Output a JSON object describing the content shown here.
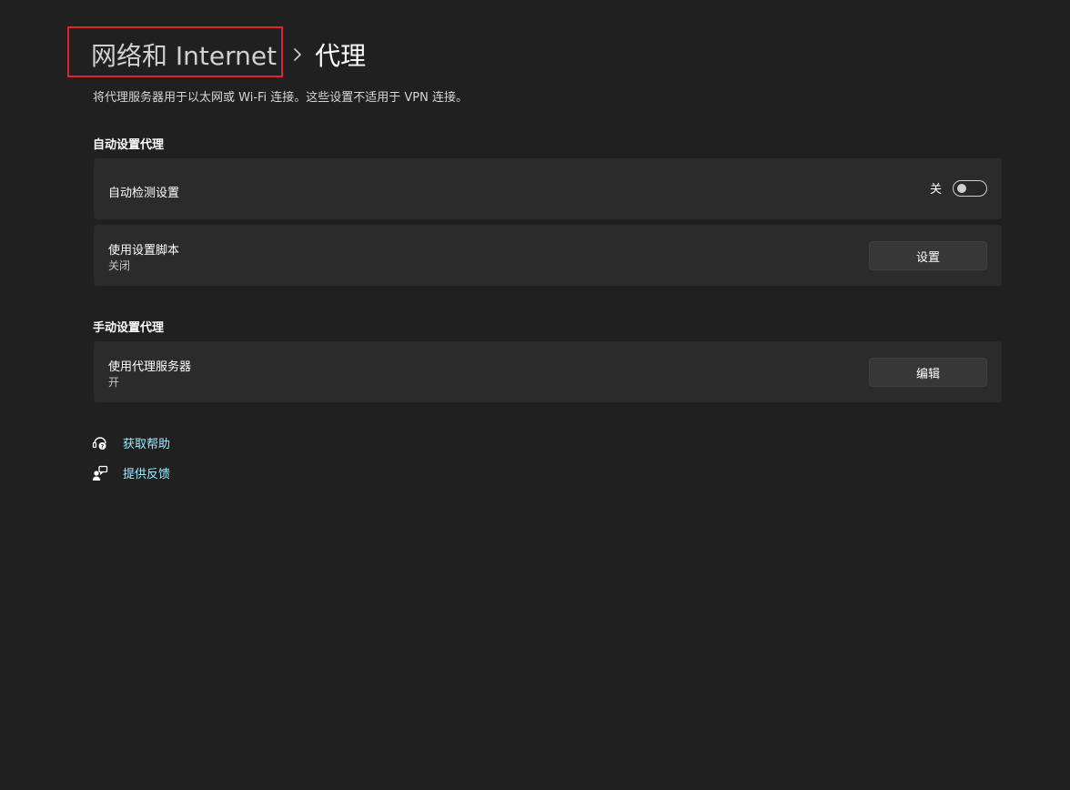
{
  "breadcrumb": {
    "parent": "网络和 Internet",
    "current": "代理"
  },
  "description": "将代理服务器用于以太网或 Wi-Fi 连接。这些设置不适用于 VPN 连接。",
  "auto_section": {
    "title": "自动设置代理",
    "detect": {
      "label": "自动检测设置",
      "state_label": "关"
    },
    "script": {
      "label": "使用设置脚本",
      "status": "关闭",
      "button_label": "设置"
    }
  },
  "manual_section": {
    "title": "手动设置代理",
    "proxy": {
      "label": "使用代理服务器",
      "status": "开",
      "button_label": "编辑"
    }
  },
  "links": {
    "help": "获取帮助",
    "feedback": "提供反馈"
  },
  "colors": {
    "background": "#202020",
    "card": "#2b2b2b",
    "link": "#99ebff",
    "highlight": "#e0262c"
  }
}
